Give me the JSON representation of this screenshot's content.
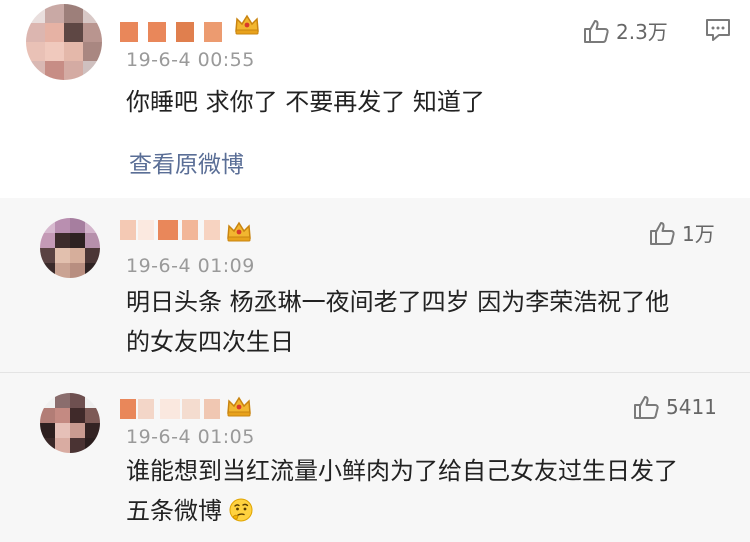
{
  "main_comment": {
    "time": "19-6-4 00:55",
    "text": "你睡吧 求你了 不要再发了 知道了",
    "likes": "2.3万",
    "view_original": "查看原微博"
  },
  "replies": [
    {
      "time": "19-6-4 01:09",
      "lines": [
        "明日头条 杨丞琳一夜间老了四岁 因为李荣浩祝了他",
        "的女友四次生日"
      ],
      "likes": "1万"
    },
    {
      "time": "19-6-4 01:05",
      "lines": [
        "谁能想到当红流量小鲜肉为了给自己女友过生日发了",
        "五条微博"
      ],
      "likes": "5411"
    }
  ],
  "colors": {
    "link": "#5a6e96",
    "vip_gold": "#e8a21c",
    "replies_background": "#f7f7f7",
    "name_mosaic": "#e9875a"
  },
  "icons": [
    "thumb-up-icon",
    "comment-icon",
    "vip-crown-icon",
    "thinking-face-emoji"
  ]
}
